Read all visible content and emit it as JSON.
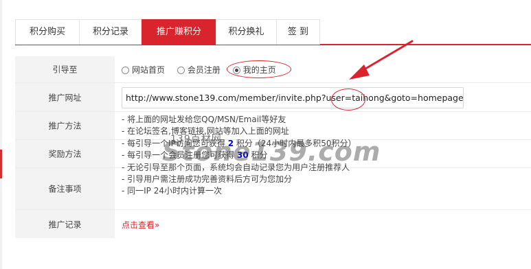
{
  "tabs": [
    {
      "label": "积分购买",
      "active": false
    },
    {
      "label": "积分记录",
      "active": false
    },
    {
      "label": "推广赚积分",
      "active": true
    },
    {
      "label": "积分换礼",
      "active": false
    },
    {
      "label": "签 到",
      "active": false
    }
  ],
  "form": {
    "guide": {
      "label": "引导至",
      "options": [
        {
          "label": "网站首页",
          "checked": false
        },
        {
          "label": "会员注册",
          "checked": false
        },
        {
          "label": "我的主页",
          "checked": true
        }
      ]
    },
    "url": {
      "label": "推广网址",
      "value": "http://www.stone139.com/member/invite.php?user=taihong&goto=homepage"
    },
    "method": {
      "label": "推广方法"
    },
    "reward": {
      "label": "奖励方法"
    },
    "notes": {
      "label": "备注事项"
    },
    "record": {
      "label": "推广记录",
      "link": "点击查看»"
    },
    "instructions": [
      "- 将上面的网址发给您QQ/MSN/Email等好友",
      "- 在论坛签名,博客链接,网站等加入上面的网址",
      "- 每引导一个IP访问您可获得 2 积分（24小时内最多积50积分）",
      "- 每引导一个会员注册您可获得 30 积分",
      "- 无论引导至那个页面，系统均会自动记录您为用户注册推荐人",
      "- 引导用户需注册成功完善资料后方可为您加分",
      "- 同一IP 24小时内计算一次"
    ],
    "reward_highlights": {
      "ip_points": "2",
      "register_points": "30"
    }
  },
  "watermark": {
    "small": "139百材网",
    "big": "Stone139.com"
  },
  "colors": {
    "accent": "#d9232d",
    "label_bg": "#f3f3f3",
    "highlight": "#0000cc"
  }
}
